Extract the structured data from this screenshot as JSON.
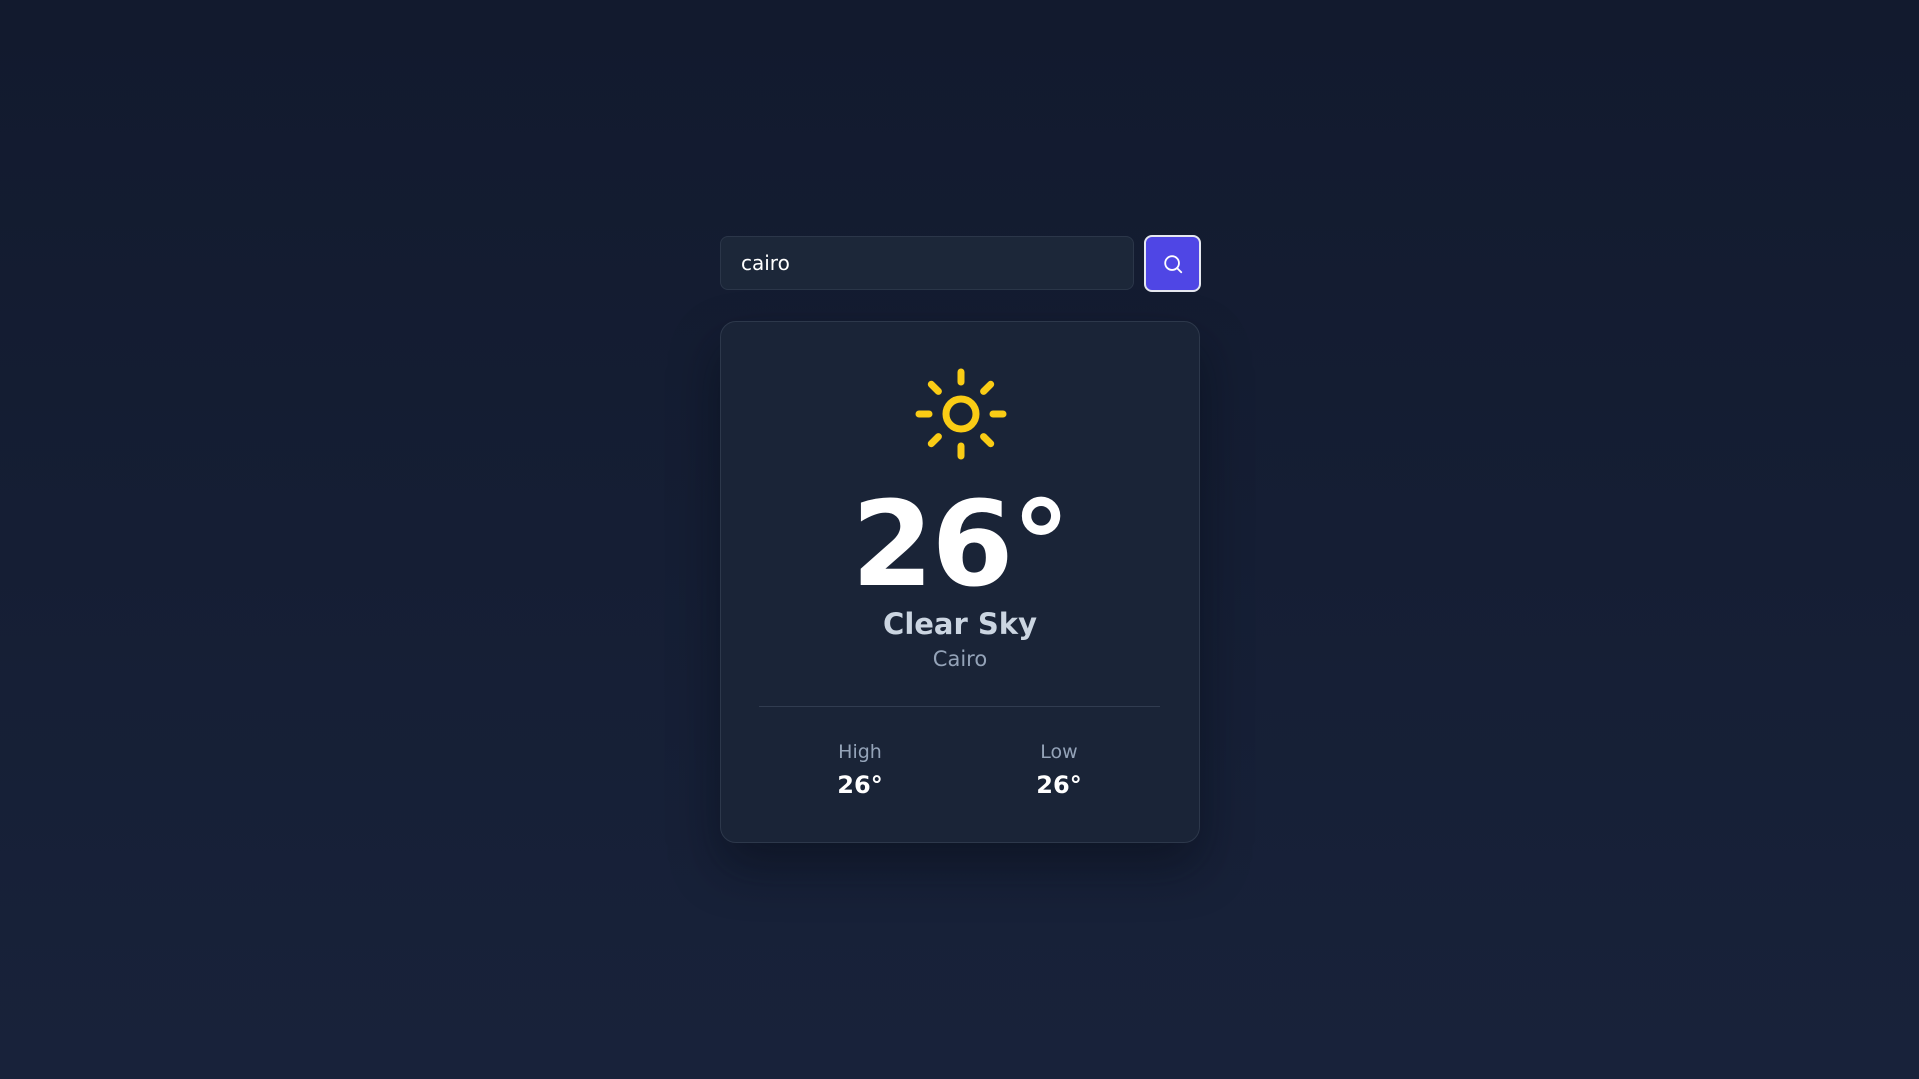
{
  "search": {
    "value": "cairo",
    "button_icon": "search-icon"
  },
  "weather": {
    "icon": "sun-icon",
    "temperature": "26°",
    "condition": "Clear Sky",
    "city": "Cairo",
    "high_label": "High",
    "high_value": "26°",
    "low_label": "Low",
    "low_value": "26°"
  },
  "colors": {
    "accent": "#4f46e5",
    "sun": "#facc15",
    "background": "#121a2e",
    "card": "#1a2437"
  }
}
